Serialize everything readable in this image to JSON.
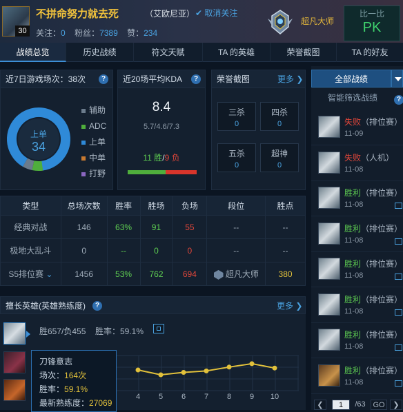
{
  "header": {
    "summoner_name": "不拼命努力就去死",
    "level": "30",
    "server": "（艾欧尼亚）",
    "follow_label": "取消关注",
    "follow_check": "✔",
    "follows_label": "关注：",
    "follows_value": "0",
    "fans_label": "粉丝：",
    "fans_value": "7389",
    "likes_label": "赞：",
    "likes_value": "234",
    "rank": "超凡大师",
    "compare_label": "比一比",
    "compare_pk": "PK"
  },
  "tabs": [
    "战绩总览",
    "历史战绩",
    "符文天赋",
    "TA 的英雄",
    "荣誉截图",
    "TA 的好友"
  ],
  "games7": {
    "title": "近7日游戏场次：38次",
    "help": "?",
    "center_role": "上单",
    "center_count": "34",
    "legend": [
      {
        "label": "辅助",
        "color": "#6b7b8c"
      },
      {
        "label": "ADC",
        "color": "#4fae3c"
      },
      {
        "label": "上单",
        "color": "#2f8ad8"
      },
      {
        "label": "中单",
        "color": "#c87a30"
      },
      {
        "label": "打野",
        "color": "#8a66c0"
      }
    ],
    "ring": {
      "up_fraction": 0.895,
      "adc_fraction": 0.055,
      "support_fraction": 0.05
    }
  },
  "kda": {
    "title": "近20场平均KDA",
    "help": "?",
    "value": "8.4",
    "detail": "5.7/4.6/7.3",
    "wins": "11 胜",
    "sep": "/",
    "losses": "9 负",
    "win_fraction": 0.55
  },
  "honor": {
    "title": "荣誉截图",
    "more": "更多",
    "more_arrow": "❯",
    "boxes": [
      {
        "label": "三杀",
        "value": "0"
      },
      {
        "label": "四杀",
        "value": "0"
      },
      {
        "label": "五杀",
        "value": "0"
      },
      {
        "label": "超神",
        "value": "0"
      }
    ]
  },
  "table": {
    "headers": [
      "类型",
      "总场次数",
      "胜率",
      "胜场",
      "负场",
      "段位",
      "胜点"
    ],
    "rows": [
      {
        "type": "经典对战",
        "total": "146",
        "rate": "63%",
        "wins": "91",
        "losses": "55",
        "tier": "--",
        "points": "--"
      },
      {
        "type": "极地大乱斗",
        "total": "0",
        "rate": "--",
        "wins": "0",
        "losses": "0",
        "tier": "--",
        "points": "--"
      },
      {
        "type": "S5排位赛",
        "total": "1456",
        "rate": "53%",
        "wins": "762",
        "losses": "694",
        "tier": "超凡大师",
        "points": "380"
      }
    ]
  },
  "champions": {
    "title": "擅长英雄(英雄熟练度)",
    "help": "?",
    "more": "更多",
    "more_arrow": "❯",
    "summary_wl": "胜657/负455",
    "summary_rate": "胜率：59.1%",
    "tooltip": {
      "name": "刀锋意志",
      "games_label": "场次：",
      "games_value": "164次",
      "rate_label": "胜率：",
      "rate_value": "59.1%",
      "mastery_label": "最新熟练度：",
      "mastery_value": "27069"
    },
    "chart_ticks": [
      "4",
      "5",
      "6",
      "7",
      "8",
      "9",
      "10"
    ]
  },
  "chart_data": {
    "type": "line",
    "x": [
      4,
      5,
      6,
      7,
      8,
      9,
      10
    ],
    "values": [
      3,
      2,
      2.5,
      2.8,
      3.6,
      4.3,
      3.4
    ],
    "color": "#e2c13b"
  },
  "matches": {
    "all_label": "全部战绩",
    "smart_filter": "智能筛选战绩",
    "help": "?",
    "items": [
      {
        "result": "失败",
        "mode": "（排位赛）",
        "date": "11-09",
        "win": false
      },
      {
        "result": "失败",
        "mode": "（人机）",
        "date": "11-08",
        "win": false
      },
      {
        "result": "胜利",
        "mode": "（排位赛）",
        "date": "11-08",
        "win": true
      },
      {
        "result": "胜利",
        "mode": "（排位赛）",
        "date": "11-08",
        "win": true
      },
      {
        "result": "胜利",
        "mode": "（排位赛）",
        "date": "11-08",
        "win": true
      },
      {
        "result": "胜利",
        "mode": "（排位赛）",
        "date": "11-08",
        "win": true
      },
      {
        "result": "胜利",
        "mode": "（排位赛）",
        "date": "11-08",
        "win": true
      },
      {
        "result": "胜利",
        "mode": "（排位赛）",
        "date": "11-08",
        "win": true
      }
    ],
    "pager": {
      "prev": "❮",
      "page": "1",
      "total": "/63",
      "go": "GO",
      "next": "❯"
    }
  }
}
